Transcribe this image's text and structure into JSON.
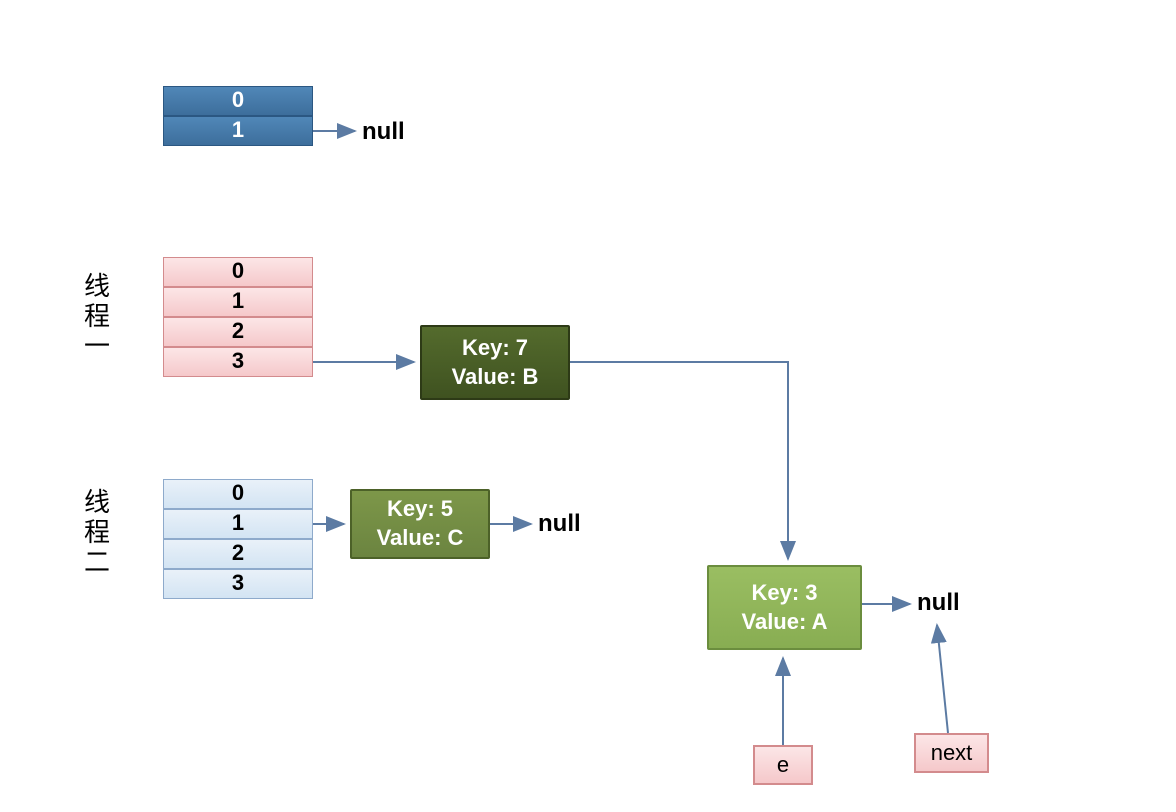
{
  "thread1_label": "线程一",
  "thread2_label": "线程二",
  "null_text": "null",
  "top_table": {
    "rows": [
      "0",
      "1"
    ]
  },
  "pink_table": {
    "rows": [
      "0",
      "1",
      "2",
      "3"
    ]
  },
  "lightblue_table": {
    "rows": [
      "0",
      "1",
      "2",
      "3"
    ]
  },
  "node_7": {
    "line1": "Key: 7",
    "line2": "Value: B"
  },
  "node_5": {
    "line1": "Key: 5",
    "line2": "Value: C"
  },
  "node_3": {
    "line1": "Key: 3",
    "line2": "Value: A"
  },
  "box_e": "e",
  "box_next": "next"
}
